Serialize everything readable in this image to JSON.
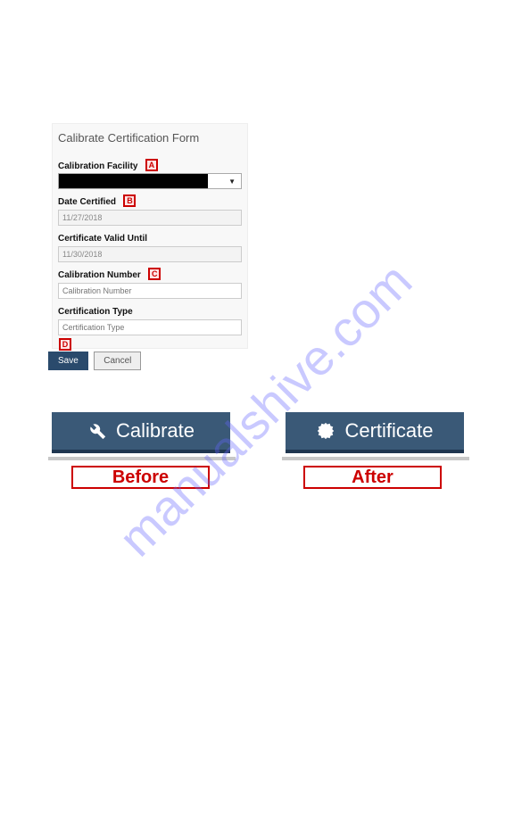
{
  "watermark": "manualshive.com",
  "form": {
    "title": "Calibrate Certification Form",
    "facility_label": "Calibration Facility",
    "date_certified_label": "Date Certified",
    "date_certified_value": "11/27/2018",
    "valid_until_label": "Certificate Valid Until",
    "valid_until_value": "11/30/2018",
    "cal_number_label": "Calibration Number",
    "cal_number_placeholder": "Calibration Number",
    "cert_type_label": "Certification Type",
    "cert_type_placeholder": "Certification Type",
    "save_label": "Save",
    "cancel_label": "Cancel"
  },
  "markers": {
    "a": "A",
    "b": "B",
    "c": "C",
    "d": "D"
  },
  "tabs": {
    "calibrate": "Calibrate",
    "certificate": "Certificate"
  },
  "states": {
    "before": "Before",
    "after": "After"
  }
}
